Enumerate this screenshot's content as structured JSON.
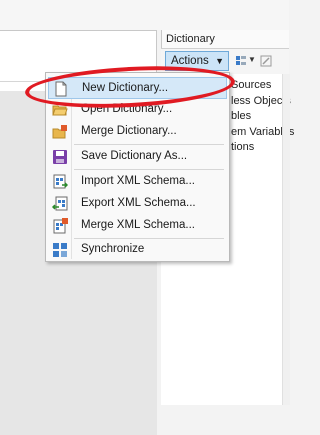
{
  "dictionary_panel": {
    "title": "Dictionary",
    "actions_label": "Actions",
    "tree_fragments": [
      "Sources",
      "less Objects",
      "bles",
      "em Variables",
      "tions"
    ]
  },
  "actions_menu": {
    "items": [
      {
        "label": "New Dictionary...",
        "icon": "new-file-icon",
        "highlighted": true
      },
      {
        "label": "Open Dictionary...",
        "icon": "open-folder-icon"
      },
      {
        "label": "Merge Dictionary...",
        "icon": "merge-folder-icon"
      },
      {
        "label": "Save Dictionary As...",
        "icon": "save-icon"
      },
      {
        "label": "Import XML Schema...",
        "icon": "import-xml-icon"
      },
      {
        "label": "Export XML Schema...",
        "icon": "export-xml-icon"
      },
      {
        "label": "Merge XML Schema...",
        "icon": "merge-xml-icon"
      },
      {
        "label": "Synchronize",
        "icon": "sync-icon"
      }
    ]
  },
  "colors": {
    "highlight": "#d5e8f8",
    "annotation": "#e01a22"
  }
}
